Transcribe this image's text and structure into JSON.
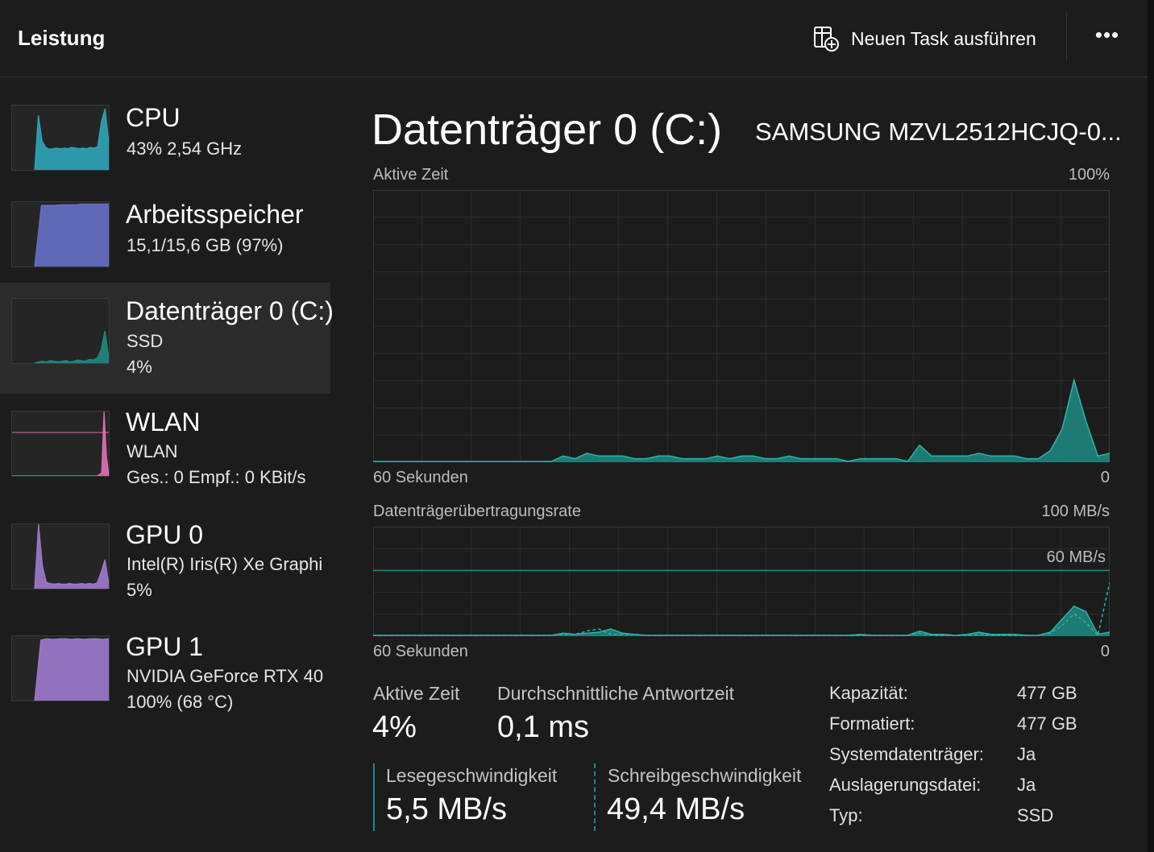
{
  "header": {
    "title": "Leistung",
    "run_task_label": "Neuen Task ausführen",
    "more_label": "•••"
  },
  "sidebar": {
    "items": [
      {
        "title": "CPU",
        "line1": "43%  2,54 GHz",
        "line2": "",
        "color": "#2fa5b8"
      },
      {
        "title": "Arbeitsspeicher",
        "line1": "15,1/15,6 GB (97%)",
        "line2": "",
        "color": "#6670c8",
        "level": 0.97
      },
      {
        "title": "Datenträger 0 (C:)",
        "line1": "SSD",
        "line2": "4%",
        "color": "#1d8c84",
        "selected": true
      },
      {
        "title": "WLAN",
        "line1": "WLAN",
        "line2": "Ges.: 0  Empf.: 0 KBit/s",
        "color": "#e070b8"
      },
      {
        "title": "GPU 0",
        "line1": "Intel(R) Iris(R) Xe Graphi",
        "line2": "5%",
        "color": "#9f7ad0"
      },
      {
        "title": "GPU 1",
        "line1": "NVIDIA GeForce RTX 40",
        "line2": "100%  (68 °C)",
        "color": "#9f7ad0",
        "level": 0.96
      }
    ]
  },
  "main": {
    "title": "Datenträger 0 (C:)",
    "model": "SAMSUNG MZVL2512HCJQ-0...",
    "graph1": {
      "label": "Aktive Zeit",
      "max_label": "100%",
      "x_left": "60 Sekunden",
      "x_right": "0"
    },
    "graph2": {
      "label": "Datenträgerübertragungsrate",
      "max_label": "100 MB/s",
      "line_label": "60 MB/s",
      "x_left": "60 Sekunden",
      "x_right": "0"
    },
    "stats": {
      "active_label": "Aktive Zeit",
      "active_value": "4%",
      "resp_label": "Durchschnittliche Antwortzeit",
      "resp_value": "0,1 ms",
      "read_label": "Lesegeschwindigkeit",
      "read_value": "5,5 MB/s",
      "write_label": "Schreibgeschwindigkeit",
      "write_value": "49,4 MB/s"
    },
    "properties": [
      {
        "key": "Kapazität:",
        "value": "477 GB"
      },
      {
        "key": "Formatiert:",
        "value": "477 GB"
      },
      {
        "key": "Systemdatenträger:",
        "value": "Ja"
      },
      {
        "key": "Auslagerungsdatei:",
        "value": "Ja"
      },
      {
        "key": "Typ:",
        "value": "SSD"
      }
    ]
  },
  "chart_data": [
    {
      "type": "area",
      "title": "Aktive Zeit",
      "ylim": [
        0,
        100
      ],
      "x_range_seconds": [
        60,
        0
      ],
      "values": [
        0,
        0,
        0,
        0,
        0,
        0,
        0,
        0,
        0,
        0,
        0,
        0,
        0,
        0,
        0,
        0,
        2,
        1,
        3,
        2,
        2,
        2,
        1,
        1,
        2,
        2,
        1,
        1,
        1,
        2,
        1,
        2,
        2,
        1,
        1,
        2,
        1,
        1,
        1,
        1,
        0,
        1,
        1,
        1,
        1,
        0,
        6,
        2,
        2,
        2,
        2,
        3,
        2,
        2,
        2,
        1,
        1,
        4,
        12,
        30,
        15,
        2,
        3
      ],
      "color": "#1d8c84"
    },
    {
      "type": "area",
      "title": "Datenträgerübertragungsrate",
      "ylim": [
        0,
        100
      ],
      "reference_line": 60,
      "x_range_seconds": [
        60,
        0
      ],
      "series": [
        {
          "name": "Lesegeschwindigkeit",
          "values": [
            0,
            0,
            0,
            0,
            0,
            0,
            0,
            0,
            0,
            0,
            0,
            0,
            0,
            0,
            0,
            0,
            2,
            1,
            2,
            3,
            6,
            2,
            1,
            0,
            0,
            0,
            0,
            0,
            0,
            0,
            0,
            0,
            0,
            0,
            0,
            0,
            0,
            0,
            0,
            0,
            0,
            1,
            0,
            0,
            0,
            0,
            4,
            1,
            1,
            0,
            1,
            3,
            1,
            1,
            1,
            0,
            0,
            3,
            15,
            27,
            22,
            1,
            3
          ]
        },
        {
          "name": "Schreibgeschwindigkeit",
          "values": [
            0,
            0,
            0,
            0,
            0,
            0,
            0,
            0,
            0,
            0,
            0,
            0,
            0,
            0,
            0,
            0,
            1,
            1,
            4,
            6,
            1,
            1,
            1,
            0,
            0,
            0,
            0,
            0,
            0,
            0,
            0,
            0,
            0,
            0,
            0,
            0,
            0,
            0,
            0,
            0,
            0,
            0,
            0,
            0,
            0,
            0,
            2,
            0,
            0,
            0,
            0,
            1,
            0,
            0,
            0,
            0,
            0,
            2,
            9,
            20,
            12,
            0,
            49
          ]
        }
      ],
      "color": "#1d8c84"
    }
  ]
}
